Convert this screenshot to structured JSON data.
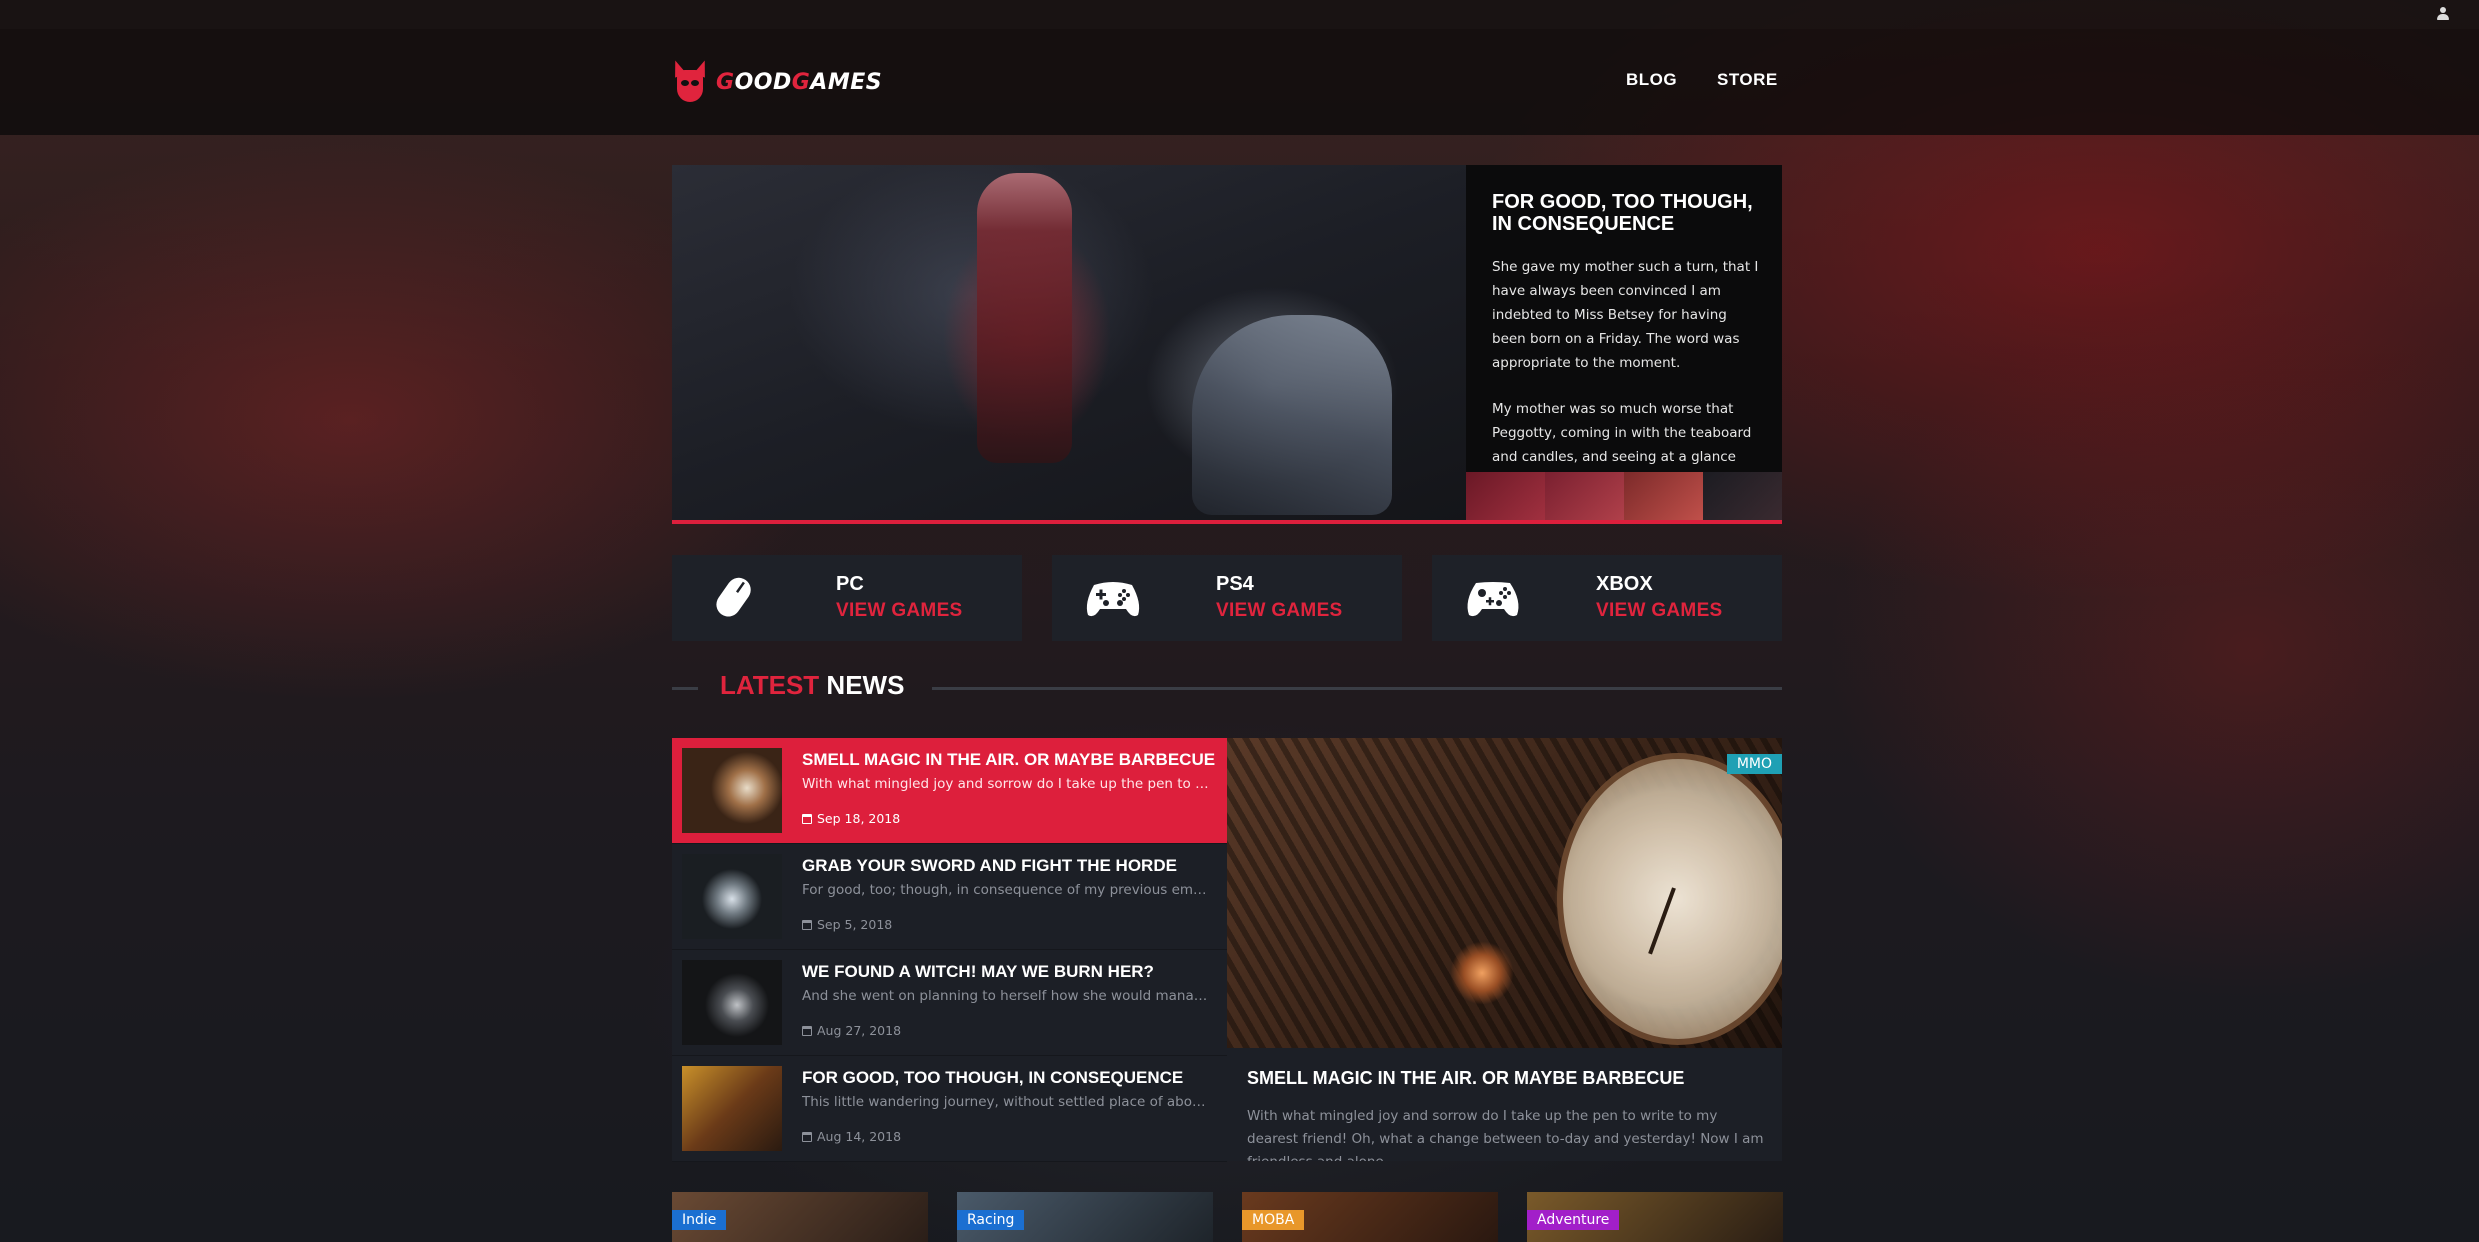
{
  "header": {
    "logo_text_first": "G",
    "logo_text_rest_a": "OOD",
    "logo_text_g": "G",
    "logo_text_rest_b": "AMES",
    "nav": [
      "BLOG",
      "STORE"
    ]
  },
  "hero": {
    "title": "FOR GOOD, TOO THOUGH, IN CONSEQUENCE",
    "paragraphs": [
      "She gave my mother such a turn, that I have always been convinced I am indebted to Miss Betsey for having been born on a Friday. The word was appropriate to the moment.",
      "My mother was so much worse that Peggotty, coming in with the teaboard and candles, and seeing at a glance"
    ]
  },
  "platforms": [
    {
      "name": "PC",
      "link": "VIEW GAMES",
      "icon": "mouse-icon"
    },
    {
      "name": "PS4",
      "link": "VIEW GAMES",
      "icon": "gamepad-icon"
    },
    {
      "name": "XBOX",
      "link": "VIEW GAMES",
      "icon": "xbox-controller-icon"
    }
  ],
  "latest_news": {
    "title_accent": "LATEST",
    "title_rest": "NEWS",
    "items": [
      {
        "title": "SMELL MAGIC IN THE AIR. OR MAYBE BARBECUE",
        "excerpt": "With what mingled joy and sorrow do I take up the pen to write to my dearest friend!",
        "date": "Sep 18, 2018",
        "active": true
      },
      {
        "title": "GRAB YOUR SWORD AND FIGHT THE HORDE",
        "excerpt": "For good, too; though, in consequence of my previous emotions, I was always",
        "date": "Sep 5, 2018",
        "active": false
      },
      {
        "title": "WE FOUND A WITCH! MAY WE BURN HER?",
        "excerpt": "And she went on planning to herself how she would manage it. They must go by",
        "date": "Aug 27, 2018",
        "active": false
      },
      {
        "title": "FOR GOOD, TOO THOUGH, IN CONSEQUENCE",
        "excerpt": "This little wandering journey, without settled place of abode, was delightful",
        "date": "Aug 14, 2018",
        "active": false
      }
    ]
  },
  "featured": {
    "tag": "MMO",
    "title": "SMELL MAGIC IN THE AIR. OR MAYBE BARBECUE",
    "text": "With what mingled joy and sorrow do I take up the pen to write to my dearest friend! Oh, what a change between to-day and yesterday! Now I am friendless and alone"
  },
  "tiles": [
    {
      "tag": "Indie",
      "color": "#1b6fd1"
    },
    {
      "tag": "Racing",
      "color": "#1b6fd1"
    },
    {
      "tag": "MOBA",
      "color": "#e8972a"
    },
    {
      "tag": "Adventure",
      "color": "#a21fc9"
    }
  ],
  "colors": {
    "accent": "#dd1f3c",
    "card_bg": "#1e2128",
    "tag_mmo": "#1fa0b4"
  }
}
